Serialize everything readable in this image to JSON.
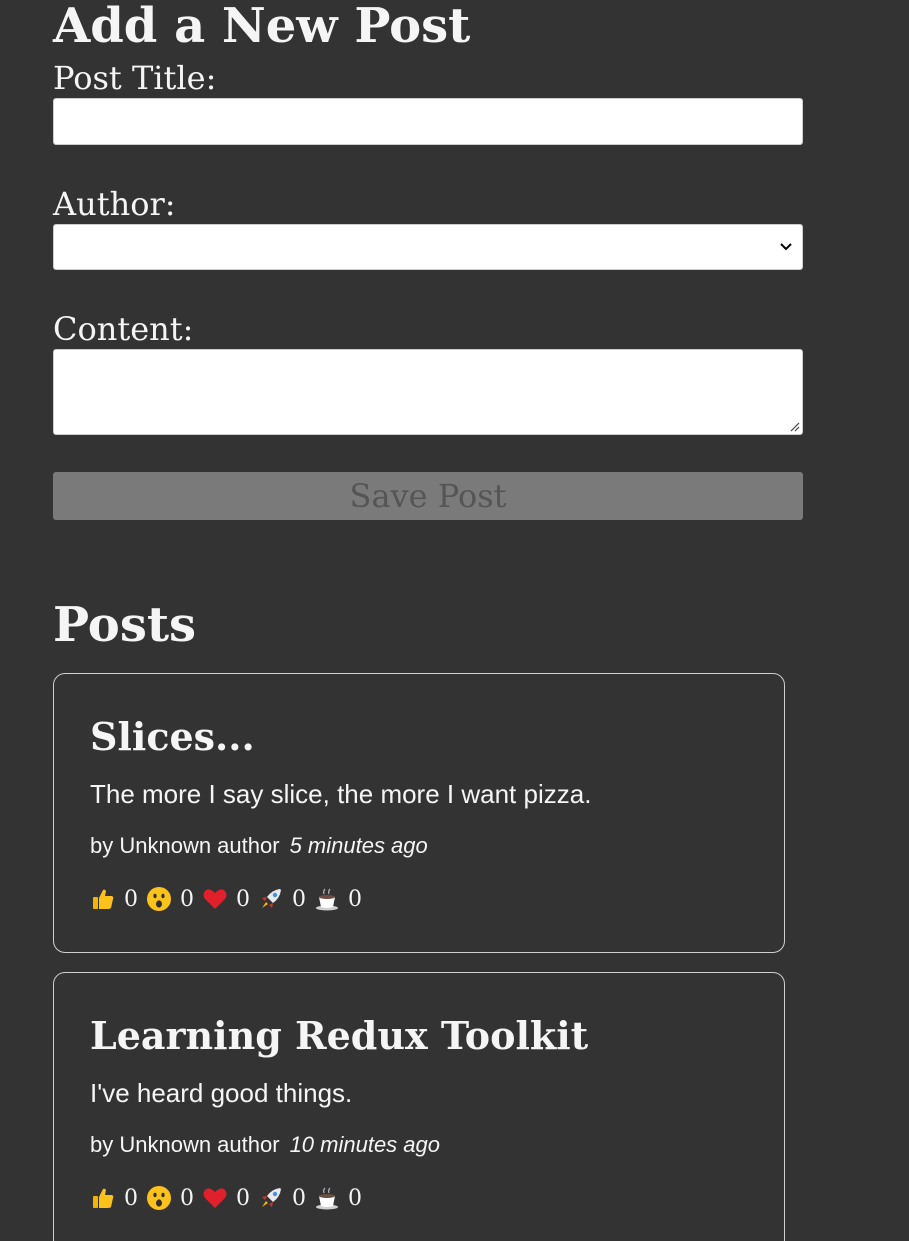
{
  "form": {
    "heading": "Add a New Post",
    "title_label": "Post Title:",
    "title_value": "",
    "author_label": "Author:",
    "author_selected": "",
    "content_label": "Content:",
    "content_value": "",
    "save_label": "Save Post",
    "save_disabled": true
  },
  "posts_heading": "Posts",
  "posts": [
    {
      "title": "Slices...",
      "content": "The more I say slice, the more I want pizza.",
      "author": "by Unknown author",
      "time": "5 minutes ago",
      "reactions": {
        "thumbsUp": "0",
        "wow": "0",
        "heart": "0",
        "rocket": "0",
        "coffee": "0"
      }
    },
    {
      "title": "Learning Redux Toolkit",
      "content": "I've heard good things.",
      "author": "by Unknown author",
      "time": "10 minutes ago",
      "reactions": {
        "thumbsUp": "0",
        "wow": "0",
        "heart": "0",
        "rocket": "0",
        "coffee": "0"
      }
    }
  ],
  "reaction_icons": [
    "thumbs-up-icon",
    "wow-face-icon",
    "heart-icon",
    "rocket-icon",
    "coffee-icon"
  ],
  "colors": {
    "background": "#333333",
    "text": "#f5f5f5",
    "save_button_bg": "#7a7a7a",
    "card_border": "#cfcfcf"
  }
}
